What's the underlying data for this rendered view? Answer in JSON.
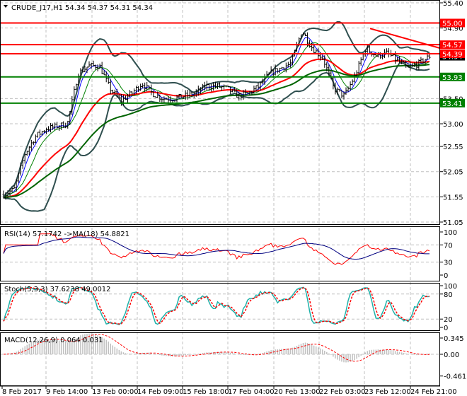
{
  "header": {
    "symbol": "CRUDE_J17,H1",
    "ohlc": "54.34 54.37 54.31 54.34"
  },
  "chart_data": [
    {
      "type": "candlestick",
      "title": "CRUDE_J17,H1",
      "ylim": [
        51.05,
        55.4
      ],
      "y_ticks": [
        "55.40",
        "54.90",
        "53.50",
        "53.00",
        "52.55",
        "52.05",
        "51.55",
        "51.05"
      ],
      "x_ticks": [
        "8 Feb 2017",
        "9 Feb 14:00",
        "13 Feb 00:00",
        "14 Feb 09:00",
        "15 Feb 18:00",
        "17 Feb 04:00",
        "20 Feb 13:00",
        "22 Feb 03:00",
        "23 Feb 12:00",
        "24 Feb 21:00"
      ],
      "approx_closes": [
        51.6,
        51.7,
        52.4,
        52.75,
        52.9,
        52.95,
        53.0,
        54.0,
        54.15,
        54.15,
        53.7,
        53.45,
        53.6,
        53.8,
        53.6,
        53.5,
        53.5,
        53.55,
        53.6,
        53.75,
        53.75,
        53.7,
        53.55,
        53.6,
        53.75,
        54.0,
        54.1,
        54.2,
        54.85,
        54.5,
        54.3,
        53.7,
        53.55,
        53.95,
        54.5,
        54.35,
        54.4,
        54.25,
        54.1,
        54.2,
        54.34
      ],
      "current_price": "54.34",
      "levels": [
        {
          "label": "55.00",
          "value": 55.0,
          "color": "#ff0000"
        },
        {
          "label": "54.57",
          "value": 54.57,
          "color": "#ff0000"
        },
        {
          "label": "54.39",
          "value": 54.39,
          "color": "#ff0000"
        },
        {
          "label": "53.93",
          "value": 53.93,
          "color": "#008000"
        },
        {
          "label": "53.41",
          "value": 53.41,
          "color": "#008000"
        }
      ],
      "trendline": {
        "from": 54.89,
        "to": 54.5,
        "color": "#ff0000"
      },
      "grid": true
    },
    {
      "type": "line",
      "title": "RSI(14) 57.1742  ->MA(18) 54.8821",
      "ylim": [
        0,
        100
      ],
      "y_ticks": [
        "100",
        "70",
        "30",
        "0"
      ],
      "series": [
        {
          "name": "RSI(14)",
          "color": "#ff0000"
        },
        {
          "name": "MA(18)",
          "color": "#000080"
        }
      ]
    },
    {
      "type": "line",
      "title": "Stoch(5,3,3) 37.6238 49.0012",
      "ylim": [
        0,
        100
      ],
      "y_ticks": [
        "100",
        "80",
        "20",
        "0"
      ],
      "series": [
        {
          "name": "main",
          "color": "#20b2aa"
        },
        {
          "name": "signal",
          "color": "#ff0000"
        }
      ]
    },
    {
      "type": "bar",
      "title": "MACD(12,26,9) 0.064 0.031",
      "ylim": [
        -0.461,
        0.345
      ],
      "y_ticks": [
        "0.345",
        "0.00",
        "-0.461"
      ],
      "series": [
        {
          "name": "MACD",
          "color": "#c0c0c0"
        },
        {
          "name": "signal",
          "color": "#ff0000"
        }
      ]
    }
  ]
}
